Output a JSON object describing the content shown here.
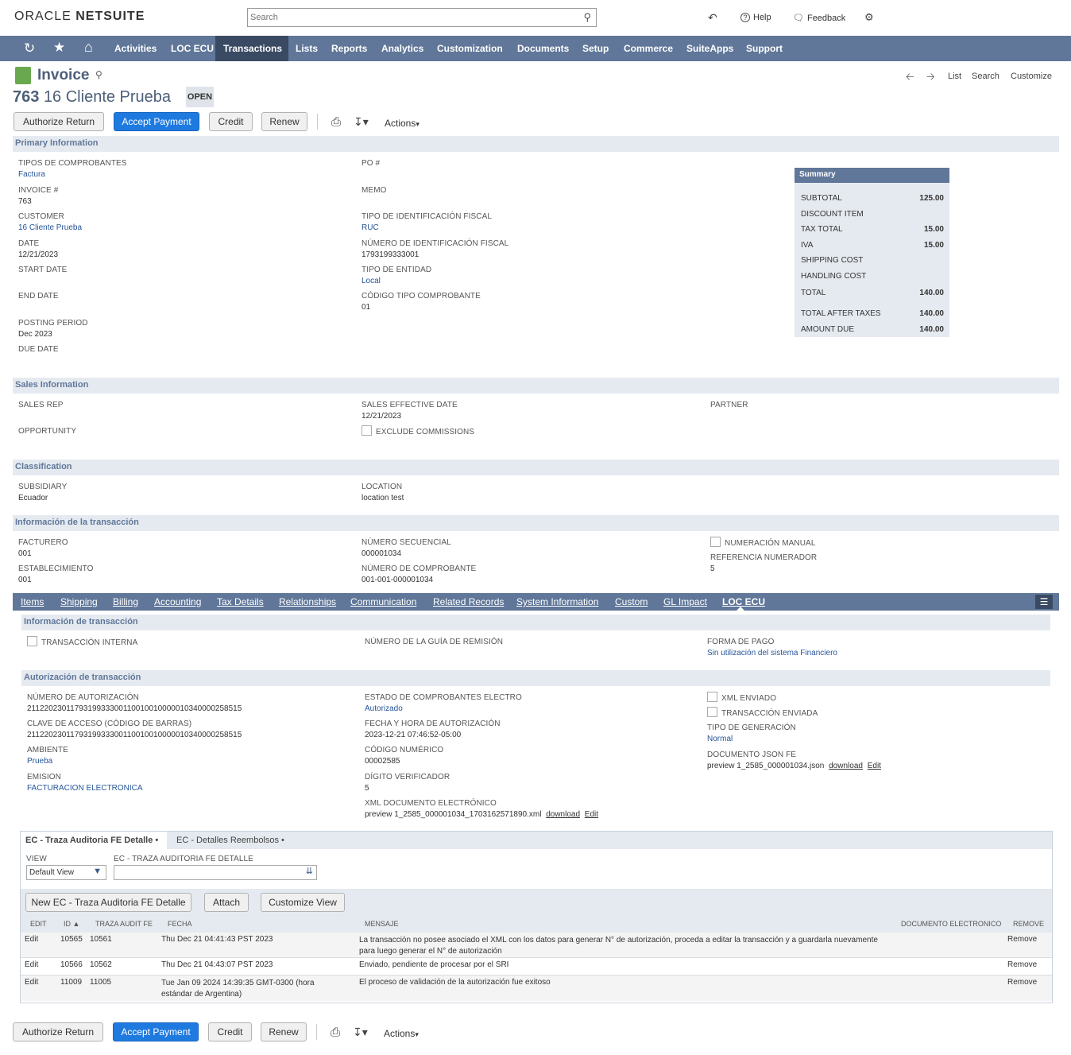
{
  "header": {
    "logo_a": "ORACLE",
    "logo_b": "NETSUITE",
    "search_placeholder": "Search",
    "help": "Help",
    "feedback": "Feedback"
  },
  "nav": {
    "items": [
      "Activities",
      "LOC ECU",
      "Transactions",
      "Lists",
      "Reports",
      "Analytics",
      "Customization",
      "Documents",
      "Setup",
      "Commerce",
      "SuiteApps",
      "Support"
    ]
  },
  "page": {
    "type": "Invoice",
    "number": "763",
    "customer_title": "16 Cliente Prueba",
    "status": "OPEN",
    "links": {
      "list": "List",
      "search": "Search",
      "customize": "Customize"
    }
  },
  "buttons": {
    "authorize": "Authorize Return",
    "accept": "Accept Payment",
    "credit": "Credit",
    "renew": "Renew",
    "actions": "Actions"
  },
  "sections": {
    "primary": "Primary Information",
    "sales": "Sales Information",
    "classification": "Classification",
    "transaccion": "Información de la transacción"
  },
  "primary": {
    "tipos_label": "TIPOS DE COMPROBANTES",
    "tipos_value": "Factura",
    "invoice_label": "INVOICE #",
    "invoice_value": "763",
    "customer_label": "CUSTOMER",
    "customer_value": "16 Cliente Prueba",
    "date_label": "DATE",
    "date_value": "12/21/2023",
    "start_label": "START DATE",
    "end_label": "END DATE",
    "posting_label": "POSTING PERIOD",
    "posting_value": "Dec 2023",
    "due_label": "DUE DATE",
    "po_label": "PO #",
    "memo_label": "MEMO",
    "tipo_id_label": "TIPO DE IDENTIFICACIÓN FISCAL",
    "tipo_id_value": "RUC",
    "num_id_label": "NÚMERO DE IDENTIFICACIÓN FISCAL",
    "num_id_value": "1793199333001",
    "tipo_ent_label": "TIPO DE ENTIDAD",
    "tipo_ent_value": "Local",
    "cod_tipo_label": "CÓDIGO TIPO COMPROBANTE",
    "cod_tipo_value": "01"
  },
  "summary": {
    "title": "Summary",
    "rows": [
      {
        "label": "SUBTOTAL",
        "value": "125.00"
      },
      {
        "label": "DISCOUNT ITEM",
        "value": ""
      },
      {
        "label": "TAX TOTAL",
        "value": "15.00"
      },
      {
        "label": "IVA",
        "value": "15.00"
      },
      {
        "label": "SHIPPING COST",
        "value": ""
      },
      {
        "label": "HANDLING COST",
        "value": ""
      },
      {
        "label": "TOTAL",
        "value": "140.00"
      },
      {
        "label": "TOTAL AFTER TAXES",
        "value": "140.00"
      },
      {
        "label": "AMOUNT DUE",
        "value": "140.00"
      }
    ]
  },
  "sales": {
    "rep_label": "SALES REP",
    "opp_label": "OPPORTUNITY",
    "eff_label": "SALES EFFECTIVE DATE",
    "eff_value": "12/21/2023",
    "exclude_label": "EXCLUDE COMMISSIONS",
    "partner_label": "PARTNER"
  },
  "classification": {
    "sub_label": "SUBSIDIARY",
    "sub_value": "Ecuador",
    "loc_label": "LOCATION",
    "loc_value": "location test"
  },
  "transaccion": {
    "fact_label": "FACTURERO",
    "fact_value": "001",
    "est_label": "ESTABLECIMIENTO",
    "est_value": "001",
    "seq_label": "NÚMERO SECUENCIAL",
    "seq_value": "000001034",
    "comp_label": "NÚMERO DE COMPROBANTE",
    "comp_value": "001-001-000001034",
    "manual_label": "NUMERACIÓN MANUAL",
    "ref_label": "REFERENCIA NUMERADOR",
    "ref_value": "5"
  },
  "tabs": [
    "Items",
    "Shipping",
    "Billing",
    "Accounting",
    "Tax Details",
    "Relationships",
    "Communication",
    "Related Records",
    "System Information",
    "Custom",
    "GL Impact",
    "LOC ECU"
  ],
  "locecu": {
    "sec1": "Información de transacción",
    "sec2": "Autorización de transacción",
    "interna_label": "TRANSACCIÓN INTERNA",
    "guia_label": "NÚMERO DE LA GUÍA DE REMISIÓN",
    "forma_label": "FORMA DE PAGO",
    "forma_value": "Sin utilización del sistema Financiero",
    "auth_label": "NÚMERO DE AUTORIZACIÓN",
    "auth_value": "2112202301179319933300110010010000010340000258515",
    "clave_label": "CLAVE DE ACCESO (CÓDIGO DE BARRAS)",
    "clave_value": "2112202301179319933300110010010000010340000258515",
    "amb_label": "AMBIENTE",
    "amb_value": "Prueba",
    "emi_label": "EMISION",
    "emi_value": "FACTURACION ELECTRONICA",
    "estado_label": "ESTADO DE COMPROBANTES ELECTRO",
    "estado_value": "Autorizado",
    "fecha_label": "FECHA Y HORA DE AUTORIZACIÓN",
    "fecha_value": "2023-12-21 07:46:52-05:00",
    "codnum_label": "CÓDIGO NUMÉRICO",
    "codnum_value": "00002585",
    "digito_label": "DÍGITO VERIFICADOR",
    "digito_value": "5",
    "xmldoc_label": "XML DOCUMENTO ELECTRÓNICO",
    "xmldoc_value": "preview 1_2585_000001034_1703162571890.xml",
    "download": "download",
    "edit": "Edit",
    "xmlenv_label": "XML ENVIADO",
    "tranenv_label": "TRANSACCIÓN ENVIADA",
    "tipogen_label": "TIPO DE GENERACIÓN",
    "tipogen_value": "Normal",
    "json_label": "DOCUMENTO JSON FE",
    "json_value": "preview 1_2585_000001034.json"
  },
  "sublist": {
    "tab1": "EC - Traza Auditoria FE Detalle •",
    "tab2": "EC - Detalles Reembolsos •",
    "view_label": "VIEW",
    "view_value": "Default View",
    "filter_label": "EC - TRAZA AUDITORIA FE DETALLE",
    "new_btn": "New EC - Traza Auditoria FE Detalle",
    "attach_btn": "Attach",
    "customize_btn": "Customize View",
    "cols": [
      "EDIT",
      "ID ▲",
      "TRAZA AUDIT FE",
      "FECHA",
      "MENSAJE",
      "DOCUMENTO ELECTRONICO",
      "REMOVE"
    ],
    "rows": [
      {
        "edit": "Edit",
        "id": "10565",
        "traza": "10561",
        "fecha": "Thu Dec 21 04:41:43 PST 2023",
        "mensaje": "La transacción no posee asociado el XML con los datos para generar N° de autorización, proceda a editar la transacción y a guardarla nuevamente para luego generar el N° de autorización",
        "remove": "Remove"
      },
      {
        "edit": "Edit",
        "id": "10566",
        "traza": "10562",
        "fecha": "Thu Dec 21 04:43:07 PST 2023",
        "mensaje": "Enviado, pendiente de procesar por el SRI",
        "remove": "Remove"
      },
      {
        "edit": "Edit",
        "id": "11009",
        "traza": "11005",
        "fecha": "Tue Jan 09 2024 14:39:35 GMT-0300 (hora estándar de Argentina)",
        "mensaje": "El proceso de validación de la autorización fue exitoso",
        "remove": "Remove"
      }
    ]
  },
  "colors": {
    "nav_bg": "#607799",
    "nav_active": "#3a4a63",
    "section_bg": "#e5eaf0",
    "link": "#255599",
    "primary_btn": "#1f7ae0"
  }
}
